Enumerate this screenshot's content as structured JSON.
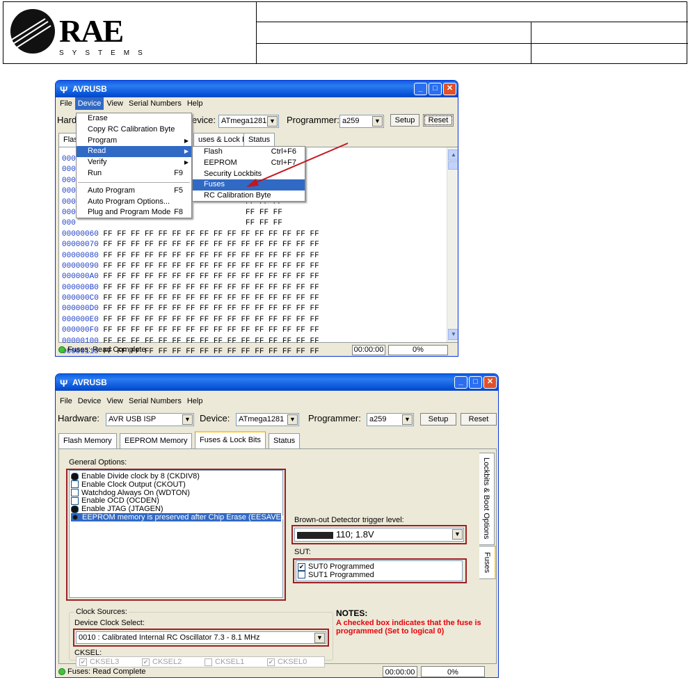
{
  "header": {
    "logo_text": "RAE",
    "logo_sub": "SYSTEMS"
  },
  "win1": {
    "title": "AVRUSB",
    "menus": [
      "File",
      "Device",
      "View",
      "Serial Numbers",
      "Help"
    ],
    "hardware_label": "Hard",
    "device_label": "evice:",
    "device_value": "ATmega1281",
    "programmer_label": "Programmer:",
    "programmer_value": "a259",
    "setup": "Setup",
    "reset": "Reset",
    "tabs": [
      "Flash",
      "uses & Lock Bits",
      "Status"
    ],
    "device_menu": [
      {
        "label": "Erase",
        "key": ""
      },
      {
        "label": "Copy RC Calibration Byte",
        "key": ""
      },
      {
        "label": "Program",
        "key": "",
        "sub": true
      },
      {
        "label": "Read",
        "key": "",
        "sub": true,
        "hl": true
      },
      {
        "label": "Verify",
        "key": "",
        "sub": true
      },
      {
        "label": "Run",
        "key": "F9"
      },
      {
        "label": "Auto Program",
        "key": "F5"
      },
      {
        "label": "Auto Program Options...",
        "key": ""
      },
      {
        "label": "Plug and Program Mode",
        "key": "F8"
      }
    ],
    "read_menu": [
      {
        "label": "Flash",
        "key": "Ctrl+F6"
      },
      {
        "label": "EEPROM",
        "key": "Ctrl+F7"
      },
      {
        "label": "Security Lockbits",
        "key": ""
      },
      {
        "label": "Fuses",
        "key": "",
        "hl": true
      },
      {
        "label": "RC Calibration Byte",
        "key": ""
      }
    ],
    "hex_partial": [
      "000",
      "000",
      "000",
      "000",
      "000",
      "000",
      "000"
    ],
    "hex_full_partial_row": "00000060",
    "hex_addresses": [
      "00000070",
      "00000080",
      "00000090",
      "000000A0",
      "000000B0",
      "000000C0",
      "000000D0",
      "000000E0",
      "000000F0",
      "00000100",
      "00000110"
    ],
    "hex_byte": "FF",
    "status": "Fuses: Read Complete",
    "time": "00:00:00",
    "progress": "0%"
  },
  "win2": {
    "title": "AVRUSB",
    "menus": [
      "File",
      "Device",
      "View",
      "Serial Numbers",
      "Help"
    ],
    "hardware_label": "Hardware:",
    "hardware_value": "AVR USB ISP",
    "device_label": "Device:",
    "device_value": "ATmega1281",
    "programmer_label": "Programmer:",
    "programmer_value": "a259",
    "setup": "Setup",
    "reset": "Reset",
    "tabs": [
      "Flash Memory",
      "EEPROM Memory",
      "Fuses & Lock Bits",
      "Status"
    ],
    "general_options_label": "General Options:",
    "options": [
      {
        "label": "Enable Divide clock by 8 (CKDIV8)",
        "mark": "blob"
      },
      {
        "label": "Enable Clock Output (CKOUT)",
        "mark": ""
      },
      {
        "label": "Watchdog Always On (WDTON)",
        "mark": ""
      },
      {
        "label": "Enable OCD (OCDEN)",
        "mark": ""
      },
      {
        "label": "Enable JTAG (JTAGEN)",
        "mark": "blob"
      },
      {
        "label": "EEPROM memory is preserved after Chip Erase (EESAVE)",
        "mark": "dot",
        "hl": true
      }
    ],
    "bod_label": "Brown-out Detector trigger level:",
    "bod_value": "110; 1.8V",
    "sut_label": "SUT:",
    "sut": [
      {
        "label": "SUT0 Programmed",
        "checked": true
      },
      {
        "label": "SUT1 Programmed",
        "checked": false
      }
    ],
    "side_tabs": [
      "Lockbits & Boot Options",
      "Fuses"
    ],
    "clock_sources_label": "Clock Sources:",
    "device_clock_label": "Device Clock Select:",
    "clock_value": "0010 : Calibrated Internal RC Oscillator 7.3 - 8.1 MHz",
    "cksel_label": "CKSEL:",
    "cksel": [
      {
        "label": "CKSEL3",
        "checked": true
      },
      {
        "label": "CKSEL2",
        "checked": true
      },
      {
        "label": "CKSEL1",
        "checked": false
      },
      {
        "label": "CKSEL0",
        "checked": true
      }
    ],
    "notes_title": "NOTES:",
    "notes_text": "A checked box indicates that the fuse is programmed (Set to logical 0)",
    "status": "Fuses: Read Complete",
    "time": "00:00:00",
    "progress": "0%"
  },
  "colors": {
    "accent_red": "#9b1f23",
    "note_red": "#e8000a",
    "select_blue": "#316ac5"
  }
}
